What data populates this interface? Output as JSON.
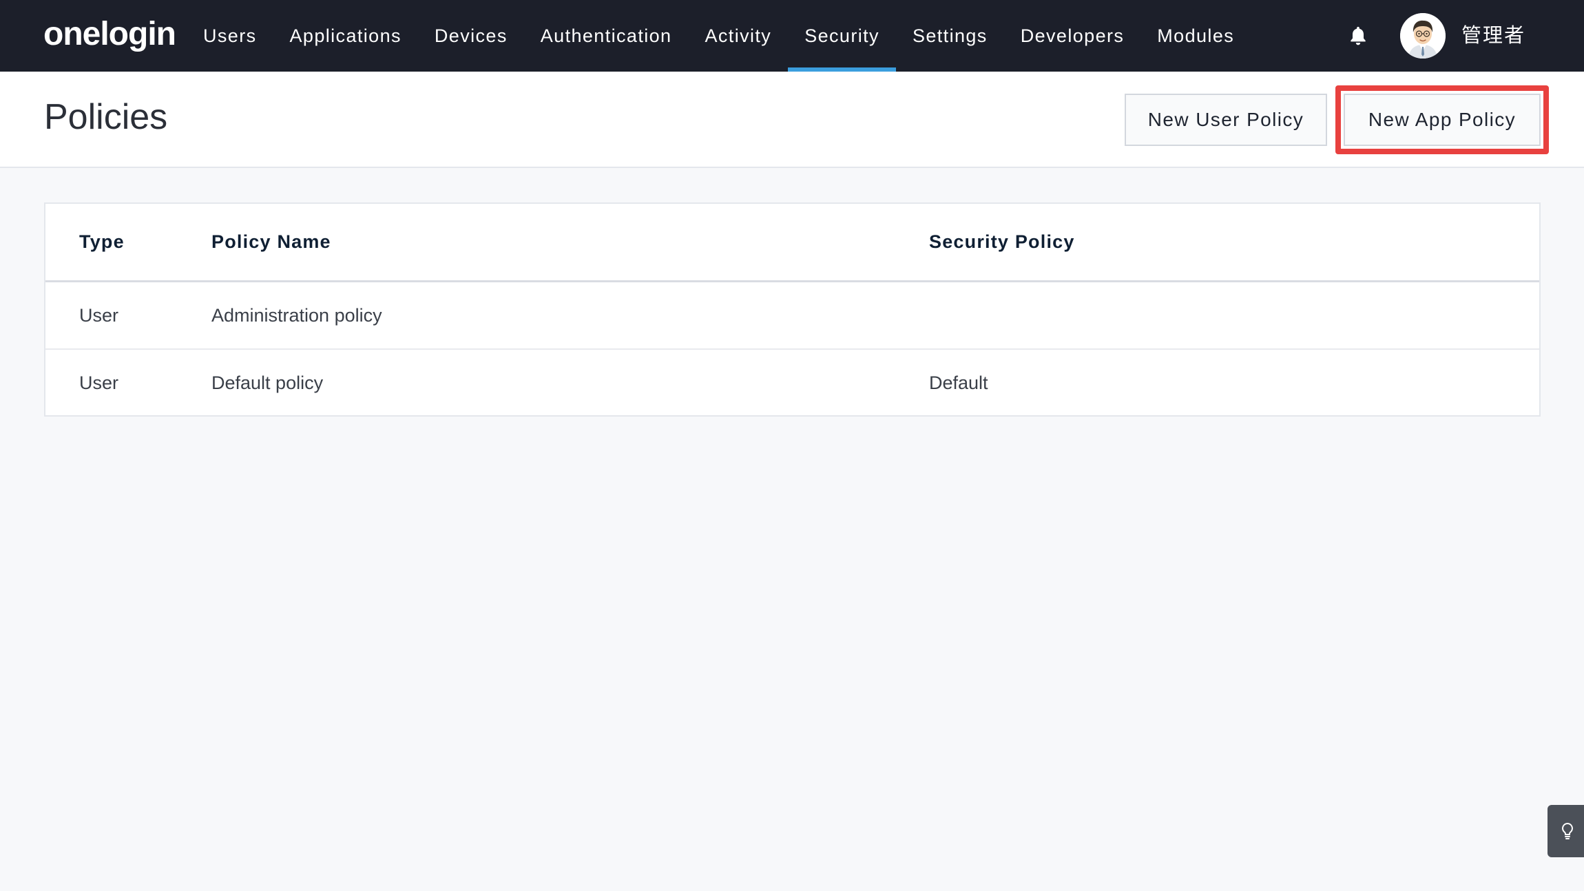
{
  "brand": {
    "logo_text": "onelogin"
  },
  "nav": {
    "items": [
      {
        "label": "Users"
      },
      {
        "label": "Applications"
      },
      {
        "label": "Devices"
      },
      {
        "label": "Authentication"
      },
      {
        "label": "Activity"
      },
      {
        "label": "Security",
        "active": true
      },
      {
        "label": "Settings"
      },
      {
        "label": "Developers"
      },
      {
        "label": "Modules"
      }
    ],
    "notification_icon": "bell-icon",
    "avatar_icon": "user-avatar",
    "user_name": "管理者"
  },
  "page": {
    "title": "Policies",
    "new_user_policy_label": "New User Policy",
    "new_app_policy_label": "New App Policy"
  },
  "table": {
    "columns": [
      "Type",
      "Policy Name",
      "Security Policy"
    ],
    "rows": [
      {
        "type": "User",
        "name": "Administration policy",
        "security_policy": ""
      },
      {
        "type": "User",
        "name": "Default policy",
        "security_policy": "Default"
      }
    ]
  },
  "help_icon": "lightbulb-icon",
  "colors": {
    "topbar_bg": "#1c1f2a",
    "active_tab_underline": "#3b9ede",
    "highlight_border": "#e8413f",
    "page_bg": "#f7f8fa"
  }
}
